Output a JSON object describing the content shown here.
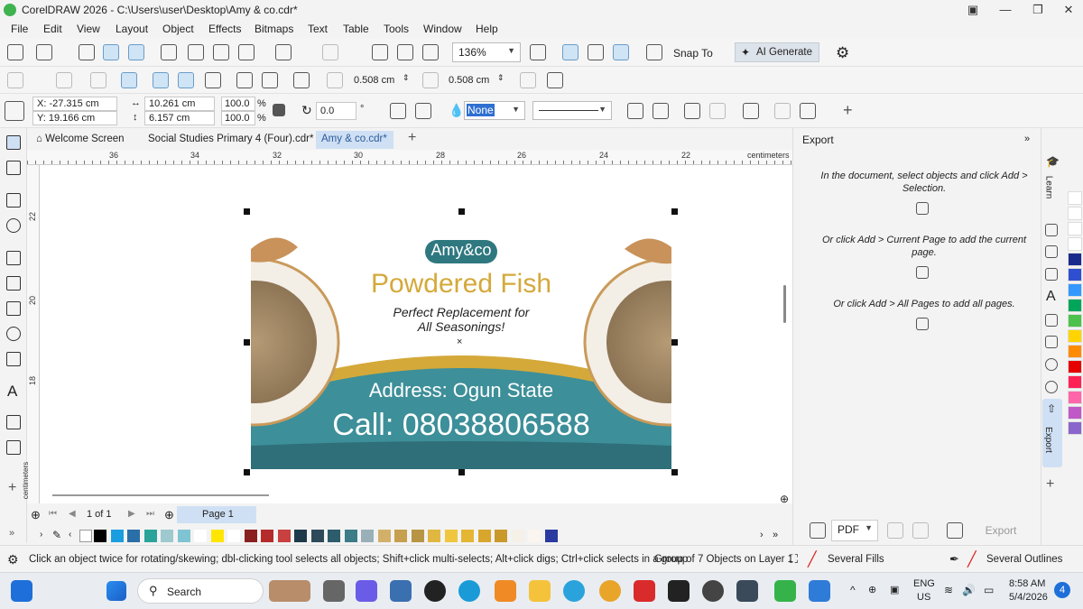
{
  "window": {
    "title": "CorelDRAW 2026 - C:\\Users\\user\\Desktop\\Amy & co.cdr*"
  },
  "menu": [
    "File",
    "Edit",
    "View",
    "Layout",
    "Object",
    "Effects",
    "Bitmaps",
    "Text",
    "Table",
    "Tools",
    "Window",
    "Help"
  ],
  "standard_toolbar": {
    "zoom": "136%",
    "snap_to": "Snap To",
    "ai_generate": "AI Generate"
  },
  "property_bar_1": {
    "corner_h": "0.508 cm",
    "corner_v": "0.508 cm"
  },
  "property_bar_2": {
    "x": "X: -27.315 cm",
    "y": "Y: 19.166 cm",
    "width": "10.261 cm",
    "height": "6.157 cm",
    "scale_w": "100.0",
    "scale_h": "100.0",
    "percent": "%",
    "rotation": "0.0",
    "degree": "°",
    "fill": "None"
  },
  "tabs": {
    "welcome": "Welcome Screen",
    "doc1": "Social Studies Primary 4 (Four).cdr*",
    "doc2": "Amy & co.cdr*"
  },
  "ruler": {
    "h_ticks": [
      "36",
      "34",
      "32",
      "30",
      "28",
      "26",
      "24",
      "22"
    ],
    "h_unit": "centimeters",
    "v_ticks": [
      "22",
      "20",
      "18"
    ],
    "v_unit": "centimeters"
  },
  "design": {
    "brand": "Amy&co",
    "headline": "Powdered Fish",
    "tagline_1": "Perfect Replacement for",
    "tagline_2": "All Seasonings!",
    "address": "Address: Ogun State",
    "phone": "Call: 08038806588",
    "colors": {
      "gold": "#d4a93a",
      "teal": "#3d8f99",
      "tealDark": "#2e6f79",
      "white": "#ffffff"
    }
  },
  "page_nav": {
    "counter": "1 of 1",
    "page_tab": "Page 1"
  },
  "status": {
    "hint": "Click an object twice for rotating/skewing; dbl-clicking tool selects all objects; Shift+click multi-selects; Alt+click digs; Ctrl+click selects in a group",
    "selection": "Group of 7 Objects on Layer 1",
    "fill": "Several Fills",
    "outline": "Several Outlines"
  },
  "docker": {
    "title": "Export",
    "msg_1": "In the document, select objects and click Add > Selection.",
    "msg_2": "Or click Add > Current Page to add the current page.",
    "msg_3": "Or click Add > All Pages to add all pages.",
    "format": "PDF",
    "export_button": "Export",
    "strip_labels": [
      "Learn",
      "Export"
    ]
  },
  "taskbar": {
    "search": "Search",
    "lang_1": "ENG",
    "lang_2": "US",
    "time": "8:58 AM",
    "date": "5/4/2026",
    "notif_count": "4"
  },
  "palette_colors": [
    "#000000",
    "#1a9ee0",
    "#2b6fa8",
    "#2aa39a",
    "#9ec9cf",
    "#7fc4d2",
    "#ffffff",
    "#ffe600",
    "#ffffff",
    "#8a1f1f",
    "#b52b2b",
    "#c94040",
    "#1e3a4a",
    "#2e4a5a",
    "#2d5c6c",
    "#3b7c88",
    "#9ab0b8",
    "#d3b06a",
    "#c6a04e",
    "#b89545",
    "#e0b841",
    "#f0c63f",
    "#e5b534",
    "#d9a62d",
    "#c99a2a",
    "#f5f0e8",
    "#faf6ef",
    "#2b3aa0"
  ],
  "right_palette": [
    "#ffffff",
    "#ffffff",
    "#ffffff",
    "#ffffff",
    "#1a2a8c",
    "#2f4fd0",
    "#3399ff",
    "#00a65a",
    "#4cc14c",
    "#ffd400",
    "#ff8c00",
    "#e60000",
    "#ff2255",
    "#ff66aa",
    "#c058c8",
    "#8a66cc"
  ]
}
